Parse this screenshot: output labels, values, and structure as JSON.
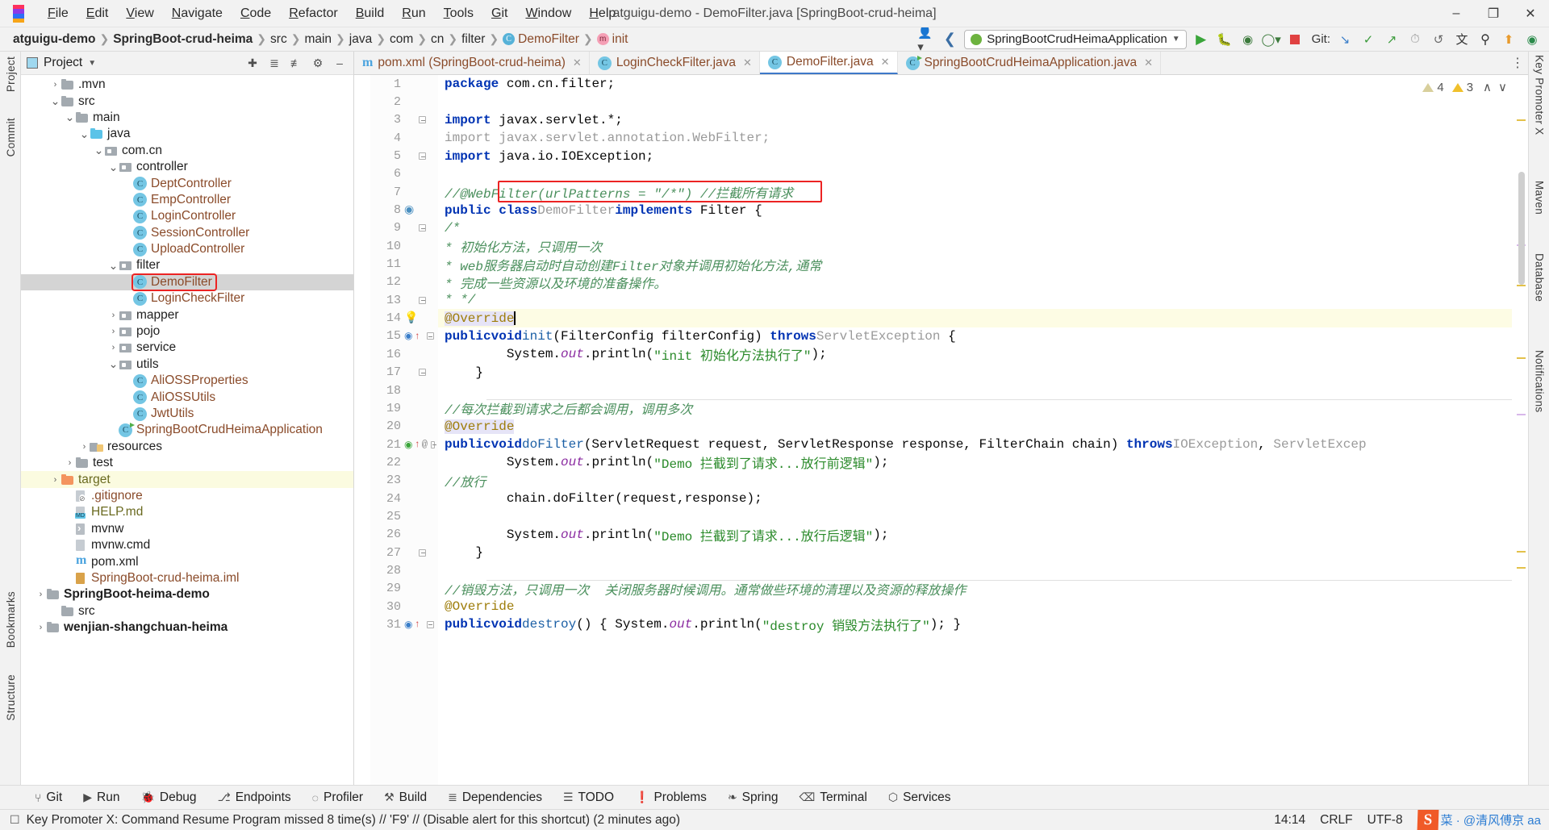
{
  "window": {
    "title": "atguigu-demo - DemoFilter.java [SpringBoot-crud-heima]",
    "minimize": "–",
    "restore": "❐",
    "close": "✕"
  },
  "menubar": [
    "File",
    "Edit",
    "View",
    "Navigate",
    "Code",
    "Refactor",
    "Build",
    "Run",
    "Tools",
    "Git",
    "Window",
    "Help"
  ],
  "breadcrumbs": [
    {
      "label": "atguigu-demo",
      "style": "bold"
    },
    {
      "label": "SpringBoot-crud-heima",
      "style": "bold"
    },
    {
      "label": "src",
      "style": "plain"
    },
    {
      "label": "main",
      "style": "plain"
    },
    {
      "label": "java",
      "style": "plain"
    },
    {
      "label": "com",
      "style": "plain"
    },
    {
      "label": "cn",
      "style": "plain"
    },
    {
      "label": "filter",
      "style": "plain"
    },
    {
      "label": "DemoFilter",
      "style": "class",
      "icon": "class-icon",
      "glyph": "C"
    },
    {
      "label": "init",
      "style": "method",
      "icon": "method-icon",
      "glyph": "m"
    }
  ],
  "toolbar": {
    "run_config": "SpringBootCrudHeimaApplication",
    "git_label": "Git:",
    "icons": [
      "profile-icon",
      "back-arrow-icon",
      "run-icon",
      "debug-icon",
      "run-coverage-icon",
      "profiler-icon",
      "stop-icon",
      "git-update-icon",
      "git-commit-icon",
      "git-push-icon",
      "git-history-icon",
      "git-rollback-icon",
      "translate-icon",
      "search-icon",
      "updates-icon",
      "ai-icon"
    ]
  },
  "left_rail": [
    {
      "label": "Project",
      "id": "rail-project"
    },
    {
      "label": "Commit",
      "id": "rail-commit"
    },
    {
      "label": "Bookmarks",
      "id": "rail-bookmarks"
    },
    {
      "label": "Structure",
      "id": "rail-structure"
    }
  ],
  "right_rail": [
    {
      "label": "Key Promoter X",
      "id": "rail-key-promoter-x"
    },
    {
      "label": "Maven",
      "id": "rail-maven"
    },
    {
      "label": "Database",
      "id": "rail-database"
    },
    {
      "label": "Notifications",
      "id": "rail-notifications"
    }
  ],
  "project_pane": {
    "title": "Project",
    "tree": [
      {
        "depth": 2,
        "arrow": "collapsed",
        "icon": "folder",
        "label": ".mvn",
        "style": "dark"
      },
      {
        "depth": 2,
        "arrow": "expanded",
        "icon": "folder",
        "label": "src",
        "style": "dark"
      },
      {
        "depth": 3,
        "arrow": "expanded",
        "icon": "folder",
        "label": "main",
        "style": "dark"
      },
      {
        "depth": 4,
        "arrow": "expanded",
        "icon": "folder-blue",
        "label": "java",
        "style": "dark"
      },
      {
        "depth": 5,
        "arrow": "expanded",
        "icon": "package",
        "label": "com.cn",
        "style": "dark"
      },
      {
        "depth": 6,
        "arrow": "expanded",
        "icon": "package",
        "label": "controller",
        "style": "dark"
      },
      {
        "depth": 7,
        "arrow": "none",
        "icon": "class",
        "label": "DeptController",
        "style": "brown"
      },
      {
        "depth": 7,
        "arrow": "none",
        "icon": "class",
        "label": "EmpController",
        "style": "brown"
      },
      {
        "depth": 7,
        "arrow": "none",
        "icon": "class",
        "label": "LoginController",
        "style": "brown"
      },
      {
        "depth": 7,
        "arrow": "none",
        "icon": "class",
        "label": "SessionController",
        "style": "brown"
      },
      {
        "depth": 7,
        "arrow": "none",
        "icon": "class",
        "label": "UploadController",
        "style": "brown"
      },
      {
        "depth": 6,
        "arrow": "expanded",
        "icon": "package",
        "label": "filter",
        "style": "dark"
      },
      {
        "depth": 7,
        "arrow": "none",
        "icon": "class",
        "label": "DemoFilter",
        "style": "brown",
        "selected": true,
        "boxed": true
      },
      {
        "depth": 7,
        "arrow": "none",
        "icon": "class",
        "label": "LoginCheckFilter",
        "style": "brown"
      },
      {
        "depth": 6,
        "arrow": "collapsed",
        "icon": "package",
        "label": "mapper",
        "style": "dark"
      },
      {
        "depth": 6,
        "arrow": "collapsed",
        "icon": "package",
        "label": "pojo",
        "style": "dark"
      },
      {
        "depth": 6,
        "arrow": "collapsed",
        "icon": "package",
        "label": "service",
        "style": "dark"
      },
      {
        "depth": 6,
        "arrow": "expanded",
        "icon": "package",
        "label": "utils",
        "style": "dark"
      },
      {
        "depth": 7,
        "arrow": "none",
        "icon": "class",
        "label": "AliOSSProperties",
        "style": "brown"
      },
      {
        "depth": 7,
        "arrow": "none",
        "icon": "class",
        "label": "AliOSSUtils",
        "style": "brown"
      },
      {
        "depth": 7,
        "arrow": "none",
        "icon": "class",
        "label": "JwtUtils",
        "style": "brown"
      },
      {
        "depth": 6,
        "arrow": "none",
        "icon": "spring-class",
        "label": "SpringBootCrudHeimaApplication",
        "style": "brown"
      },
      {
        "depth": 4,
        "arrow": "collapsed",
        "icon": "resources",
        "label": "resources",
        "style": "dark"
      },
      {
        "depth": 3,
        "arrow": "collapsed",
        "icon": "folder",
        "label": "test",
        "style": "dark"
      },
      {
        "depth": 2,
        "arrow": "collapsed",
        "icon": "folder-orange",
        "label": "target",
        "style": "olive",
        "highlight": true
      },
      {
        "depth": 3,
        "arrow": "none",
        "icon": "file-git",
        "label": ".gitignore",
        "style": "brown"
      },
      {
        "depth": 3,
        "arrow": "none",
        "icon": "file-md",
        "label": "HELP.md",
        "style": "olive"
      },
      {
        "depth": 3,
        "arrow": "none",
        "icon": "file-run",
        "label": "mvnw",
        "style": "dark"
      },
      {
        "depth": 3,
        "arrow": "none",
        "icon": "file",
        "label": "mvnw.cmd",
        "style": "dark"
      },
      {
        "depth": 3,
        "arrow": "none",
        "icon": "file-xml",
        "label": "pom.xml",
        "style": "dark"
      },
      {
        "depth": 3,
        "arrow": "none",
        "icon": "file-iml",
        "label": "SpringBoot-crud-heima.iml",
        "style": "brown"
      },
      {
        "depth": 1,
        "arrow": "collapsed",
        "icon": "folder",
        "label": "SpringBoot-heima-demo",
        "style": "boldtop"
      },
      {
        "depth": 2,
        "arrow": "none",
        "icon": "folder",
        "label": "src",
        "style": "dark"
      },
      {
        "depth": 1,
        "arrow": "collapsed",
        "icon": "folder",
        "label": "wenjian-shangchuan-heima",
        "style": "boldtop"
      }
    ]
  },
  "editor": {
    "tabs": [
      {
        "label": "pom.xml (SpringBoot-crud-heima)",
        "icon": "maven-icon",
        "active": false
      },
      {
        "label": "LoginCheckFilter.java",
        "icon": "class-icon",
        "active": false
      },
      {
        "label": "DemoFilter.java",
        "icon": "class-icon",
        "active": true
      },
      {
        "label": "SpringBootCrudHeimaApplication.java",
        "icon": "spring-icon",
        "active": false
      }
    ],
    "inspection": {
      "weak_warnings": "4",
      "warnings": "3",
      "up": "∧",
      "down": "∨"
    },
    "lines": [
      {
        "n": 1,
        "gutter": "",
        "html": "<span class='kw'>package</span> com.cn.filter;"
      },
      {
        "n": 2,
        "gutter": "",
        "html": ""
      },
      {
        "n": 3,
        "gutter": "fold",
        "html": "<span class='kw'>import</span> javax.servlet.*;"
      },
      {
        "n": 4,
        "gutter": "",
        "html": "<span class='gray'>import javax.servlet.annotation.WebFilter;</span>"
      },
      {
        "n": 5,
        "gutter": "foldend",
        "html": "<span class='kw'>import</span> java.io.IOException;"
      },
      {
        "n": 6,
        "gutter": "",
        "html": ""
      },
      {
        "n": 7,
        "gutter": "",
        "html": "<span class='cm'>//@WebFilter(urlPatterns = \"/*\") //拦截所有请求</span>"
      },
      {
        "n": 8,
        "gutter": "spring",
        "html": "<span class='kw'>public class</span> <span class='gray'>DemoFilter</span> <span class='kw'>implements</span> Filter {"
      },
      {
        "n": 9,
        "gutter": "fold",
        "html": "    <span class='cm'>/*</span>"
      },
      {
        "n": 10,
        "gutter": "",
        "html": "     <span class='cm'>* 初始化方法，只调用一次</span>"
      },
      {
        "n": 11,
        "gutter": "",
        "html": "     <span class='cm'>* web服务器启动时自动创建Filter对象并调用初始化方法,通常</span>"
      },
      {
        "n": 12,
        "gutter": "",
        "html": "     <span class='cm'>* 完成一些资源以及环境的准备操作。</span>"
      },
      {
        "n": 13,
        "gutter": "foldend",
        "html": "     <span class='cm'>* */</span>"
      },
      {
        "n": 14,
        "gutter": "bulb",
        "highlight": true,
        "html": "    <span class='annohl'>@Override</span><span class='caret'></span>"
      },
      {
        "n": 15,
        "gutter": "impl",
        "html": "    <span class='kw'>public</span> <span class='kw'>void</span> <span class='meth'>init</span>(FilterConfig filterConfig) <span class='kw'>throws</span> <span class='gray'>ServletException</span> {"
      },
      {
        "n": 16,
        "gutter": "",
        "html": "        System.<span class='fld'>out</span>.println(<span class='str'>\"init 初始化方法执行了\"</span>);"
      },
      {
        "n": 17,
        "gutter": "foldend",
        "html": "    }"
      },
      {
        "n": 18,
        "gutter": "",
        "html": ""
      },
      {
        "n": 19,
        "gutter": "",
        "html": "    <span class='cm'>//每次拦截到请求之后都会调用，调用多次</span>"
      },
      {
        "n": 20,
        "gutter": "",
        "html": "    <span class='annohl'>@Override</span>"
      },
      {
        "n": 21,
        "gutter": "impl2",
        "html": "    <span class='kw'>public</span> <span class='kw'>void</span> <span class='meth'>doFilter</span>(ServletRequest request, ServletResponse response, FilterChain chain) <span class='kw'>throws</span> <span class='gray'>IOException</span>, <span class='gray'>ServletExcep</span>"
      },
      {
        "n": 22,
        "gutter": "",
        "html": "        System.<span class='fld'>out</span>.println(<span class='str'>\"Demo 拦截到了请求...放行前逻辑\"</span>);"
      },
      {
        "n": 23,
        "gutter": "",
        "html": "        <span class='cm'>//放行</span>"
      },
      {
        "n": 24,
        "gutter": "",
        "html": "        chain.doFilter(request,response);"
      },
      {
        "n": 25,
        "gutter": "",
        "html": ""
      },
      {
        "n": 26,
        "gutter": "",
        "html": "        System.<span class='fld'>out</span>.println(<span class='str'>\"Demo 拦截到了请求...放行后逻辑\"</span>);"
      },
      {
        "n": 27,
        "gutter": "foldend",
        "html": "    }"
      },
      {
        "n": 28,
        "gutter": "",
        "html": ""
      },
      {
        "n": 29,
        "gutter": "",
        "html": "    <span class='cm'>//销毁方法，只调用一次  关闭服务器时候调用。通常做些环境的清理以及资源的释放操作</span>"
      },
      {
        "n": 30,
        "gutter": "",
        "html": "    <span class='anno'>@Override</span>"
      },
      {
        "n": 31,
        "gutter": "impl",
        "html": "    <span class='kw'>public</span> <span class='kw'>void</span> <span class='meth'>destroy</span>() { System.<span class='fld'>out</span>.println(<span class='str'>\"destroy 销毁方法执行了\"</span>); }"
      }
    ]
  },
  "tool_windows": [
    {
      "label": "Git",
      "icon": "git-branch-icon"
    },
    {
      "label": "Run",
      "icon": "run-icon"
    },
    {
      "label": "Debug",
      "icon": "debug-icon"
    },
    {
      "label": "Endpoints",
      "icon": "endpoints-icon"
    },
    {
      "label": "Profiler",
      "icon": "profiler-icon"
    },
    {
      "label": "Build",
      "icon": "build-hammer-icon"
    },
    {
      "label": "Dependencies",
      "icon": "dependencies-icon"
    },
    {
      "label": "TODO",
      "icon": "todo-list-icon"
    },
    {
      "label": "Problems",
      "icon": "problems-icon"
    },
    {
      "label": "Spring",
      "icon": "spring-leaf-icon"
    },
    {
      "label": "Terminal",
      "icon": "terminal-icon"
    },
    {
      "label": "Services",
      "icon": "services-icon"
    }
  ],
  "statusbar": {
    "message": "Key Promoter X: Command Resume Program missed 8 time(s) // 'F9' // (Disable alert for this shortcut) (2 minutes ago)",
    "caret": "14:14",
    "line_sep": "CRLF",
    "encoding": "UTF-8",
    "watermark_s": "S",
    "watermark_text": "菜 · @清风傅京 aa"
  }
}
